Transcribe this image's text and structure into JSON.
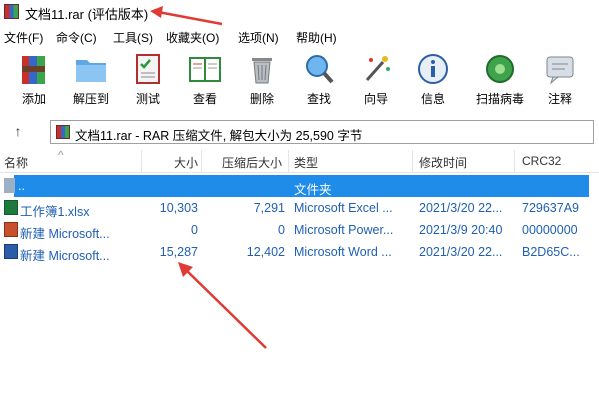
{
  "window": {
    "title": "文档11.rar (评估版本)"
  },
  "menu": [
    "文件(F)",
    "命令(C)",
    "工具(S)",
    "收藏夹(O)",
    "选项(N)",
    "帮助(H)"
  ],
  "toolbar": [
    {
      "label": "添加",
      "icon": "add-archive-icon"
    },
    {
      "label": "解压到",
      "icon": "extract-folder-icon"
    },
    {
      "label": "测试",
      "icon": "test-checklist-icon"
    },
    {
      "label": "查看",
      "icon": "view-book-icon"
    },
    {
      "label": "删除",
      "icon": "trash-icon"
    },
    {
      "label": "查找",
      "icon": "magnifier-icon"
    },
    {
      "label": "向导",
      "icon": "wizard-wand-icon"
    },
    {
      "label": "信息",
      "icon": "info-icon"
    },
    {
      "label": "扫描病毒",
      "icon": "virus-scan-icon"
    },
    {
      "label": "注释",
      "icon": "comment-icon"
    }
  ],
  "address": {
    "up_symbol": "↑",
    "text": "文档11.rar - RAR 压缩文件, 解包大小为 25,590 字节"
  },
  "columns": {
    "name": "名称",
    "sort_indicator": "^",
    "size": "大小",
    "packed": "压缩后大小",
    "type": "类型",
    "modified": "修改时间",
    "crc": "CRC32"
  },
  "rows": [
    {
      "name": "..",
      "size": "",
      "packed": "",
      "type": "文件夹",
      "modified": "",
      "crc": "",
      "icon": "folder-icon",
      "selected": true
    },
    {
      "name": "工作簿1.xlsx",
      "size": "10,303",
      "packed": "7,291",
      "type": "Microsoft Excel ...",
      "modified": "2021/3/20 22...",
      "crc": "729637A9",
      "icon": "excel-file-icon"
    },
    {
      "name": "新建 Microsoft...",
      "size": "0",
      "packed": "0",
      "type": "Microsoft Power...",
      "modified": "2021/3/9 20:40",
      "crc": "00000000",
      "icon": "powerpoint-file-icon"
    },
    {
      "name": "新建 Microsoft...",
      "size": "15,287",
      "packed": "12,402",
      "type": "Microsoft Word ...",
      "modified": "2021/3/20 22...",
      "crc": "B2D65C...",
      "icon": "word-file-icon"
    }
  ],
  "colors": {
    "selection": "#1e8ce8",
    "annotation_arrow": "#e03a34",
    "link_text": "#1f5fb3"
  }
}
